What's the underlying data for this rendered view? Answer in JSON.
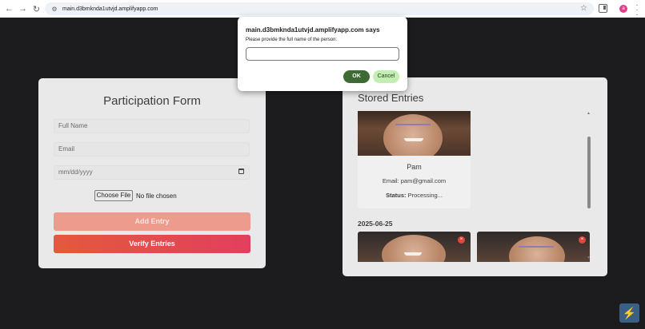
{
  "browser": {
    "url": "main.d3bmknda1utvjd.amplifyapp.com",
    "profile_initial": "a",
    "icons": [
      "back-arrow-icon",
      "forward-arrow-icon",
      "reload-icon",
      "site-settings-icon",
      "bookmark-star-icon",
      "side-panel-icon",
      "kebab-menu-icon"
    ]
  },
  "form": {
    "title": "Participation Form",
    "full_name_placeholder": "Full Name",
    "email_placeholder": "Email",
    "date_placeholder": "mm/dd/yyyy",
    "choose_file_label": "Choose File",
    "file_status": "No file chosen",
    "add_entry_label": "Add Entry",
    "verify_entries_label": "Verify Entries"
  },
  "entries": {
    "title": "Stored Entries",
    "items": [
      {
        "name": "Pam",
        "email_label": "Email:",
        "email": "pam@gmail.com",
        "status_label": "Status:",
        "status": "Processing..."
      }
    ],
    "date_group": "2025-06-25",
    "remove_icon": "×"
  },
  "dialog": {
    "title": "main.d3bmknda1utvjd.amplifyapp.com says",
    "message": "Please provide the full name of the person:",
    "input_value": "",
    "ok_label": "OK",
    "cancel_label": "Cancel"
  },
  "colors": {
    "ok": "#3e6b33",
    "cancel": "#c3eeb3",
    "verify_start": "#e4593c",
    "verify_end": "#e23f5d",
    "add_entry": "#ec9b8c",
    "badge": "#3a5f86"
  }
}
